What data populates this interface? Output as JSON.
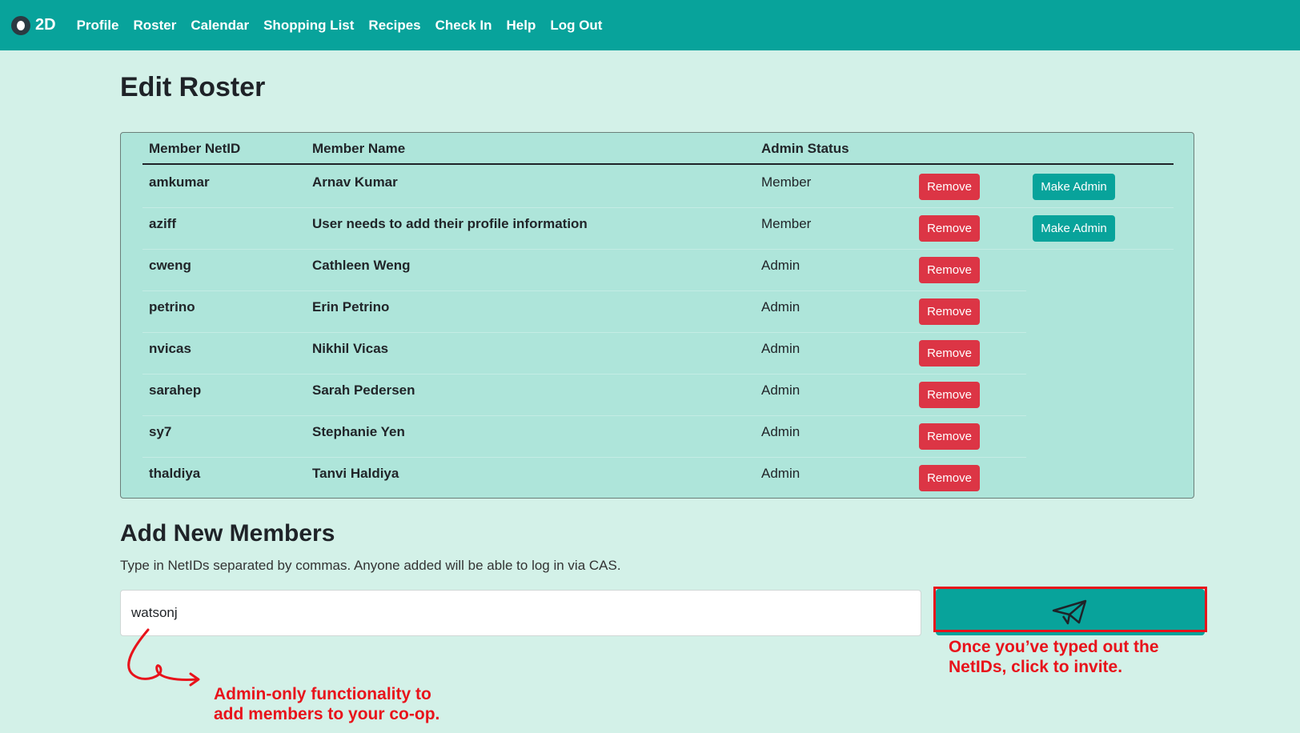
{
  "nav": {
    "brand": "2D",
    "links": [
      "Profile",
      "Roster",
      "Calendar",
      "Shopping List",
      "Recipes",
      "Check In",
      "Help",
      "Log Out"
    ]
  },
  "page": {
    "title": "Edit Roster"
  },
  "roster": {
    "headers": {
      "netid": "Member NetID",
      "name": "Member Name",
      "status": "Admin Status"
    },
    "remove_label": "Remove",
    "make_admin_label": "Make Admin",
    "rows": [
      {
        "netid": "amkumar",
        "name": "Arnav Kumar",
        "status": "Member"
      },
      {
        "netid": "aziff",
        "name": "User needs to add their profile information",
        "status": "Member"
      },
      {
        "netid": "cweng",
        "name": "Cathleen Weng",
        "status": "Admin"
      },
      {
        "netid": "petrino",
        "name": "Erin Petrino",
        "status": "Admin"
      },
      {
        "netid": "nvicas",
        "name": "Nikhil Vicas",
        "status": "Admin"
      },
      {
        "netid": "sarahep",
        "name": "Sarah Pedersen",
        "status": "Admin"
      },
      {
        "netid": "sy7",
        "name": "Stephanie Yen",
        "status": "Admin"
      },
      {
        "netid": "thaldiya",
        "name": "Tanvi Haldiya",
        "status": "Admin"
      }
    ]
  },
  "add_members": {
    "title": "Add New Members",
    "help": "Type in NetIDs separated by commas. Anyone added will be able to log in via CAS.",
    "input_value": "watsonj"
  },
  "annotations": {
    "invite": [
      "Once you’ve typed out the",
      "NetIDs, click to invite."
    ],
    "admin": [
      "Admin-only functionality to",
      "add members to your co-op."
    ]
  },
  "colors": {
    "accent": "#08a39b",
    "background": "#d3f1e8",
    "table_bg": "#aee5da",
    "danger": "#dc3545",
    "annotation": "#e8131b"
  }
}
